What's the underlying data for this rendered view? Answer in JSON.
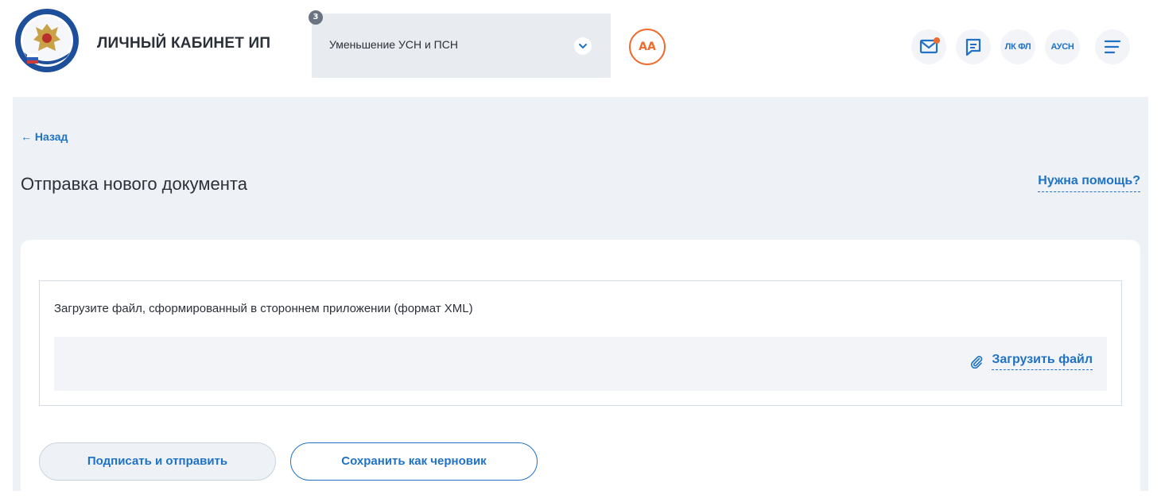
{
  "header": {
    "brand": "ЛИЧНЫЙ КАБИНЕТ ИП",
    "mode_select": {
      "value": "Уменьшение УСН и ПСН",
      "badge_count": "3"
    },
    "avatar_initials": "АА",
    "buttons": {
      "lk_fl": "ЛК ФЛ",
      "ausn": "АУСН"
    }
  },
  "nav": {
    "back": "← Назад"
  },
  "page": {
    "title": "Отправка нового документа",
    "help": "Нужна помощь?"
  },
  "upload": {
    "hint": "Загрузите файл, сформированный в стороннем приложении (формат XML)",
    "link": "Загрузить файл"
  },
  "actions": {
    "sign_send": "Подписать и отправить",
    "save_draft": "Сохранить как черновик"
  },
  "colors": {
    "accent": "#1f72c6",
    "avatar": "#f06b2d",
    "background": "#eef2f6"
  }
}
